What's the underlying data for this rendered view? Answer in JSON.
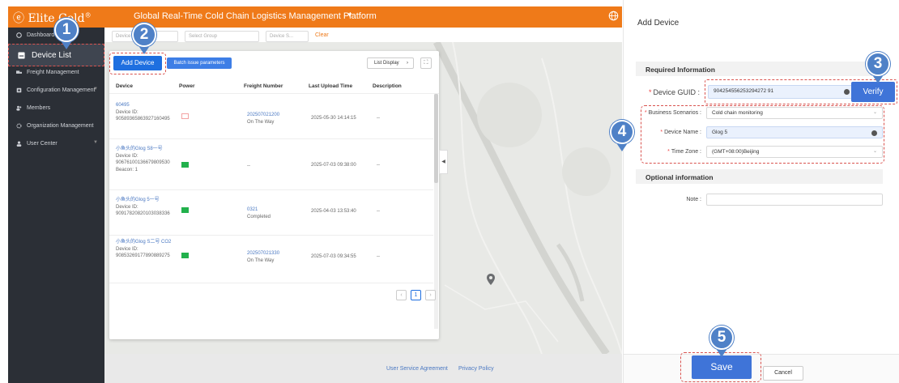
{
  "header": {
    "brand": "Elite",
    "brand_suffix": "Cold",
    "brand_mark": "®",
    "platform_title": "Global Real-Time Cold Chain Logistics Management Platform"
  },
  "sidebar": {
    "items": [
      {
        "label": "Dashboard",
        "icon": "dashboard-icon"
      },
      {
        "label": "Device List",
        "icon": "device-icon",
        "active": true
      },
      {
        "label": "Freight Management",
        "icon": "truck-icon"
      },
      {
        "label": "Configuration Management",
        "icon": "config-icon",
        "expandable": true
      },
      {
        "label": "Members",
        "icon": "members-icon"
      },
      {
        "label": "Organization Management",
        "icon": "org-icon"
      },
      {
        "label": "User Center",
        "icon": "user-icon",
        "expandable": true
      }
    ]
  },
  "filters": {
    "device_placeholder": "Device Na...e...",
    "group_placeholder": "Select Group",
    "status_placeholder": "Device S...",
    "clear": "Clear"
  },
  "toolbar": {
    "add_device": "Add Device",
    "batch_issue": "Batch issue parameters",
    "list_display": "List Display"
  },
  "table": {
    "columns": [
      "Device",
      "Power",
      "Freight Number",
      "Last Upload Time",
      "Description"
    ],
    "rows": [
      {
        "name": "60495",
        "id_label": "Device ID:",
        "id": "90589365863927160495",
        "extra": "",
        "power": "empty",
        "freight": "202507021200",
        "freight_status": "On The Way",
        "upload": "2025-05-30 14:14:15",
        "desc": "--"
      },
      {
        "name": "小鱼头的Glog S8一号",
        "id_label": "Device ID:",
        "id": "90676100136679809530",
        "extra": "Beacon: 1",
        "power": "full",
        "freight": "",
        "freight_status": "--",
        "upload": "2025-07-03 09:38:00",
        "desc": "--"
      },
      {
        "name": "小鱼头的Glog 5一号",
        "id_label": "Device ID:",
        "id": "90917820820103038336",
        "extra": "",
        "power": "full",
        "freight": "0321",
        "freight_status": "Completed",
        "upload": "2025-04-03 13:53:40",
        "desc": "--"
      },
      {
        "name": "小鱼头的Glog S二号 CO2",
        "id_label": "Device ID:",
        "id": "90853269177890889275",
        "extra": "",
        "power": "full",
        "freight": "202507021330",
        "freight_status": "On The Way",
        "upload": "2025-07-03 09:34:55",
        "desc": "--"
      }
    ],
    "current_page": "1"
  },
  "footer": {
    "agreement": "User Service Agreement",
    "privacy": "Privacy Policy"
  },
  "drawer": {
    "title": "Add Device",
    "required_section": "Required Information",
    "guid_label": "Device GUID :",
    "guid_value": "904254556253294272 91",
    "verify": "Verify",
    "scenario_label": "Business Scenarios :",
    "scenario_value": "Cold chain monitoring",
    "name_label": "Device Name :",
    "name_value": "Glog 5",
    "timezone_label": "Time Zone :",
    "timezone_value": "(GMT+08:00)Beijing",
    "optional_section": "Optional information",
    "note_label": "Note :",
    "save": "Save",
    "cancel": "Cancel"
  },
  "steps": [
    "1",
    "2",
    "3",
    "4",
    "5"
  ],
  "colors": {
    "accent": "#ef7a19",
    "primary": "#3f74d8",
    "sidebar": "#2b2f36",
    "power_ok": "#22b14c",
    "annotation": "#4f81c7"
  }
}
